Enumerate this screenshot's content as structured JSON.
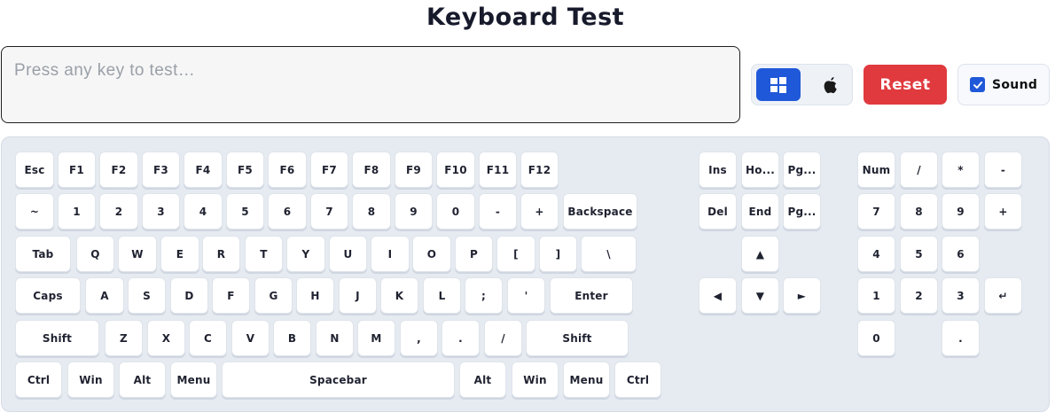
{
  "header": {
    "title": "Keyboard Test"
  },
  "input": {
    "placeholder": "Press any key to test…"
  },
  "controls": {
    "os_options": [
      {
        "name": "windows-icon",
        "selected": true
      },
      {
        "name": "apple-icon",
        "selected": false
      }
    ],
    "reset_label": "Reset",
    "sound_label": "Sound",
    "sound_checked": true
  },
  "colors": {
    "accent": "#1f58d8",
    "reset": "#e03a3e",
    "keyboard_bg": "#e6ebf2",
    "key_bg": "#ffffff"
  },
  "keyboard": {
    "main_rows": [
      [
        "Esc",
        "F1",
        "F2",
        "F3",
        "F4",
        "F5",
        "F6",
        "F7",
        "F8",
        "F9",
        "F10",
        "F11",
        "F12"
      ],
      [
        "~",
        "1",
        "2",
        "3",
        "4",
        "5",
        "6",
        "7",
        "8",
        "9",
        "0",
        "-",
        "+",
        "Backspace"
      ],
      [
        "Tab",
        "Q",
        "W",
        "E",
        "R",
        "T",
        "Y",
        "U",
        "I",
        "O",
        "P",
        "[",
        "]",
        "\\"
      ],
      [
        "Caps",
        "A",
        "S",
        "D",
        "F",
        "G",
        "H",
        "J",
        "K",
        "L",
        ";",
        "'",
        "Enter"
      ],
      [
        "Shift",
        "Z",
        "X",
        "C",
        "V",
        "B",
        "N",
        "M",
        ",",
        ".",
        "/",
        "Shift"
      ],
      [
        "Ctrl",
        "Win",
        "Alt",
        "Menu",
        "Spacebar",
        "Alt",
        "Win",
        "Menu",
        "Ctrl"
      ]
    ],
    "nav_keys": [
      "Ins",
      "Ho...",
      "Pg...",
      "Del",
      "End",
      "Pg...",
      "▲",
      "◀",
      "▼",
      "►"
    ],
    "numpad_keys": [
      "Num",
      "/",
      "*",
      "-",
      "7",
      "8",
      "9",
      "+",
      "4",
      "5",
      "6",
      "1",
      "2",
      "3",
      "↵",
      "0",
      "."
    ]
  }
}
